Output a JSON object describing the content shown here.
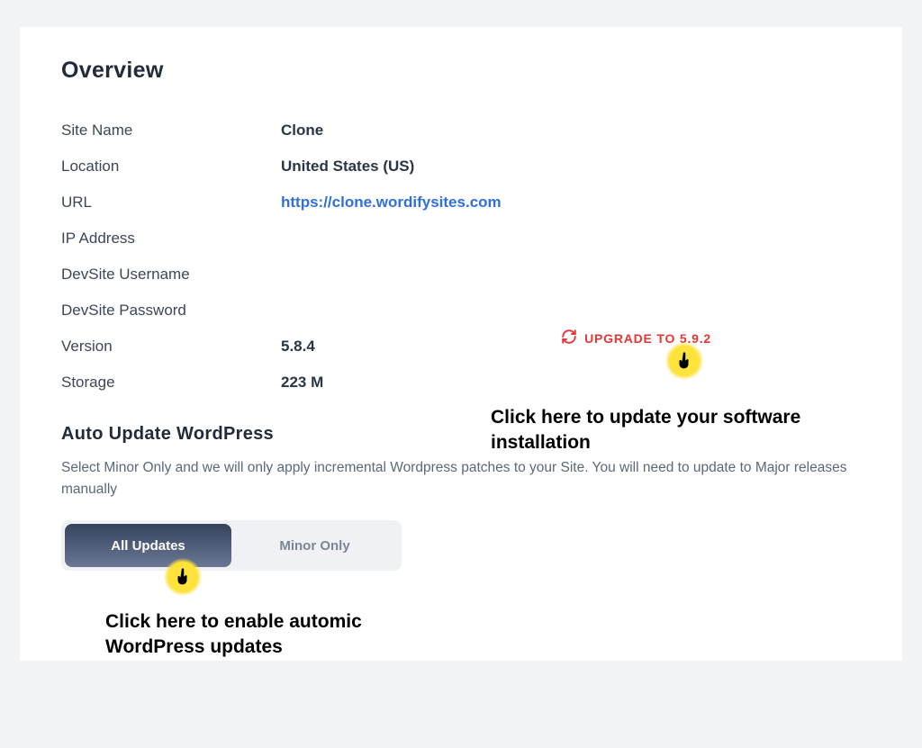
{
  "overview": {
    "title": "Overview",
    "rows": {
      "site_name": {
        "label": "Site Name",
        "value": "Clone"
      },
      "location": {
        "label": "Location",
        "value": "United States (US)"
      },
      "url": {
        "label": "URL",
        "value": "https://clone.wordifysites.com"
      },
      "ip": {
        "label": "IP Address",
        "value": ""
      },
      "dev_user": {
        "label": "DevSite Username",
        "value": ""
      },
      "dev_pass": {
        "label": "DevSite Password",
        "value": ""
      },
      "version": {
        "label": "Version",
        "value": "5.8.4"
      },
      "storage": {
        "label": "Storage",
        "value": "223 M"
      }
    },
    "upgrade_label": "UPGRADE TO 5.9.2"
  },
  "auto_update": {
    "title": "Auto Update WordPress",
    "help": "Select Minor Only and we will only apply incremental Wordpress patches to your Site. You will need to update to Major releases manually",
    "option_all": "All Updates",
    "option_minor": "Minor Only"
  },
  "annotations": {
    "upgrade": "Click here to update your software installation",
    "updates": "Click here to enable automic WordPress updates"
  }
}
